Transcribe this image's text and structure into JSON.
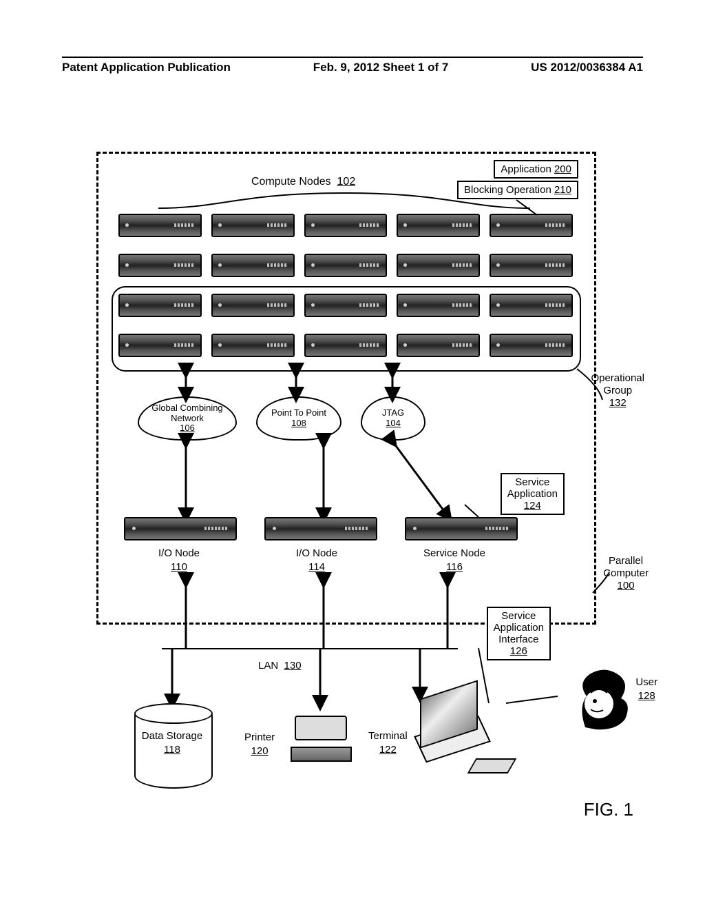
{
  "header": {
    "left": "Patent Application Publication",
    "center": "Feb. 9, 2012  Sheet 1 of 7",
    "right": "US 2012/0036384 A1"
  },
  "callouts": {
    "application": {
      "text": "Application",
      "num": "200"
    },
    "blocking": {
      "text": "Blocking Operation",
      "num": "210"
    },
    "compute": {
      "text": "Compute Nodes",
      "num": "102"
    }
  },
  "op_group": {
    "label": "Operational\nGroup",
    "num": "132"
  },
  "networks": {
    "gcn": {
      "label": "Global Combining\nNetwork",
      "num": "106"
    },
    "ptp": {
      "label": "Point To Point",
      "num": "108"
    },
    "jtag": {
      "label": "JTAG",
      "num": "104"
    }
  },
  "service_app": {
    "text": "Service\nApplication",
    "num": "124"
  },
  "lower_nodes": [
    {
      "label": "I/O Node",
      "num": "110"
    },
    {
      "label": "I/O Node",
      "num": "114"
    },
    {
      "label": "Service Node",
      "num": "116"
    }
  ],
  "parallel": {
    "label": "Parallel\nComputer",
    "num": "100"
  },
  "service_iface": {
    "text": "Service\nApplication\nInterface",
    "num": "126"
  },
  "lan": {
    "label": "LAN",
    "num": "130"
  },
  "storage": {
    "label": "Data Storage",
    "num": "118"
  },
  "printer": {
    "label": "Printer",
    "num": "120"
  },
  "terminal": {
    "label": "Terminal",
    "num": "122"
  },
  "user": {
    "label": "User",
    "num": "128"
  },
  "figure_label": "FIG. 1"
}
